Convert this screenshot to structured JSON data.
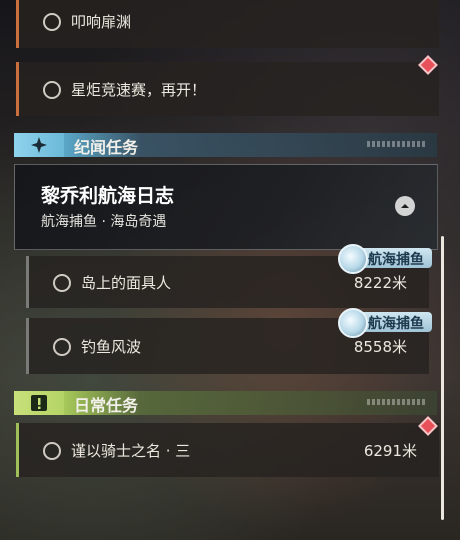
{
  "quests_top": [
    {
      "label": "叩响扉渊"
    },
    {
      "label": "星炬竞速赛，再开！"
    }
  ],
  "section_story": {
    "title": "纪闻任务",
    "card": {
      "title": "黎乔利航海日志",
      "subtitle": "航海捕鱼 · 海岛奇遇"
    },
    "items": [
      {
        "label": "岛上的面具人",
        "distance": "8222米",
        "badge": "航海捕鱼"
      },
      {
        "label": "钓鱼风波",
        "distance": "8558米",
        "badge": "航海捕鱼"
      }
    ]
  },
  "section_daily": {
    "title": "日常任务",
    "items": [
      {
        "label": "谨以骑士之名 · 三",
        "distance": "6291米"
      }
    ]
  },
  "colors": {
    "story_accent": "#8fd3ec",
    "daily_accent": "#c8e07a",
    "quest_bar": "#c9703e",
    "marker": "#e8505a"
  },
  "icons": {
    "story": "sparkle-icon",
    "daily": "exclamation-box-icon",
    "expand": "chevron-up-icon",
    "fishing": "fishing-wave-icon"
  }
}
